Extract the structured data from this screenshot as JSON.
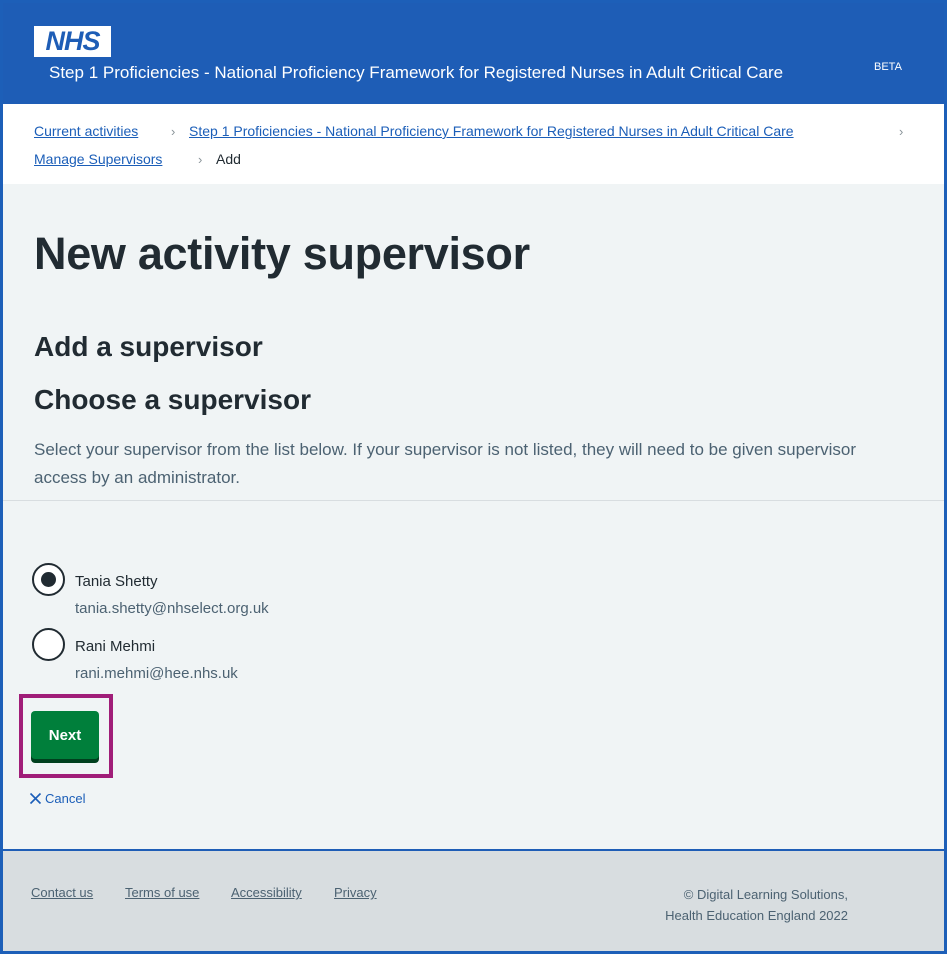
{
  "header": {
    "logo_text": "NHS",
    "service_name": "Step 1 Proficiencies - National Proficiency Framework for Registered Nurses in Adult Critical Care",
    "beta_label": "BETA",
    "colors": {
      "header_bg": "#1e5db6",
      "link": "#1b5eb8",
      "button": "#007f3b",
      "focus_outline": "#a01d78"
    }
  },
  "breadcrumb": {
    "items": [
      {
        "label": "Current activities"
      },
      {
        "label": "Step 1 Proficiencies - National Proficiency Framework for Registered Nurses in Adult Critical Care"
      },
      {
        "label": "Manage Supervisors"
      }
    ],
    "current": "Add",
    "separator": "›"
  },
  "main": {
    "title": "New activity supervisor",
    "subtitle": "Add a supervisor",
    "section_heading": "Choose a supervisor",
    "hint": "Select your supervisor from the list below. If your supervisor is not listed, they will need to be given supervisor access by an administrator."
  },
  "supervisors": [
    {
      "name": "Tania Shetty",
      "email": "tania.shetty@nhselect.org.uk",
      "selected": true
    },
    {
      "name": "Rani Mehmi",
      "email": "rani.mehmi@hee.nhs.uk",
      "selected": false
    }
  ],
  "actions": {
    "next_label": "Next",
    "cancel_label": "Cancel",
    "cancel_icon": "close-icon"
  },
  "footer": {
    "links": [
      "Contact us",
      "Terms of use",
      "Accessibility",
      "Privacy"
    ],
    "copyright_line1": "© Digital Learning Solutions,",
    "copyright_line2": "Health Education England 2022"
  }
}
